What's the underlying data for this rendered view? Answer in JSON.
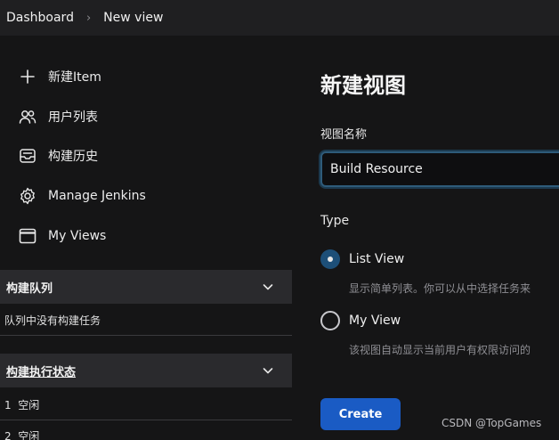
{
  "breadcrumb": {
    "home": "Dashboard",
    "current": "New view"
  },
  "sidebar": {
    "items": [
      {
        "label": "新建Item",
        "icon": "plus-icon"
      },
      {
        "label": "用户列表",
        "icon": "users-icon"
      },
      {
        "label": "构建历史",
        "icon": "inbox-icon"
      },
      {
        "label": "Manage Jenkins",
        "icon": "gear-icon"
      },
      {
        "label": "My Views",
        "icon": "window-icon"
      }
    ],
    "queue": {
      "title": "构建队列",
      "empty": "队列中没有构建任务"
    },
    "executors": {
      "title": "构建执行状态",
      "rows": [
        {
          "num": "1",
          "status": "空闲"
        },
        {
          "num": "2",
          "status": "空闲"
        }
      ]
    }
  },
  "main": {
    "title": "新建视图",
    "name_label": "视图名称",
    "name_value": "Build Resource",
    "type_label": "Type",
    "options": [
      {
        "label": "List View",
        "desc": "显示简单列表。你可以从中选择任务来",
        "checked": true
      },
      {
        "label": "My View",
        "desc": "该视图自动显示当前用户有权限访问的",
        "checked": false
      }
    ],
    "create_label": "Create"
  },
  "watermark": "CSDN @TopGames",
  "colors": {
    "accent": "#1a5bc4",
    "focus_ring": "#2e5b7a",
    "background": "#151516"
  }
}
